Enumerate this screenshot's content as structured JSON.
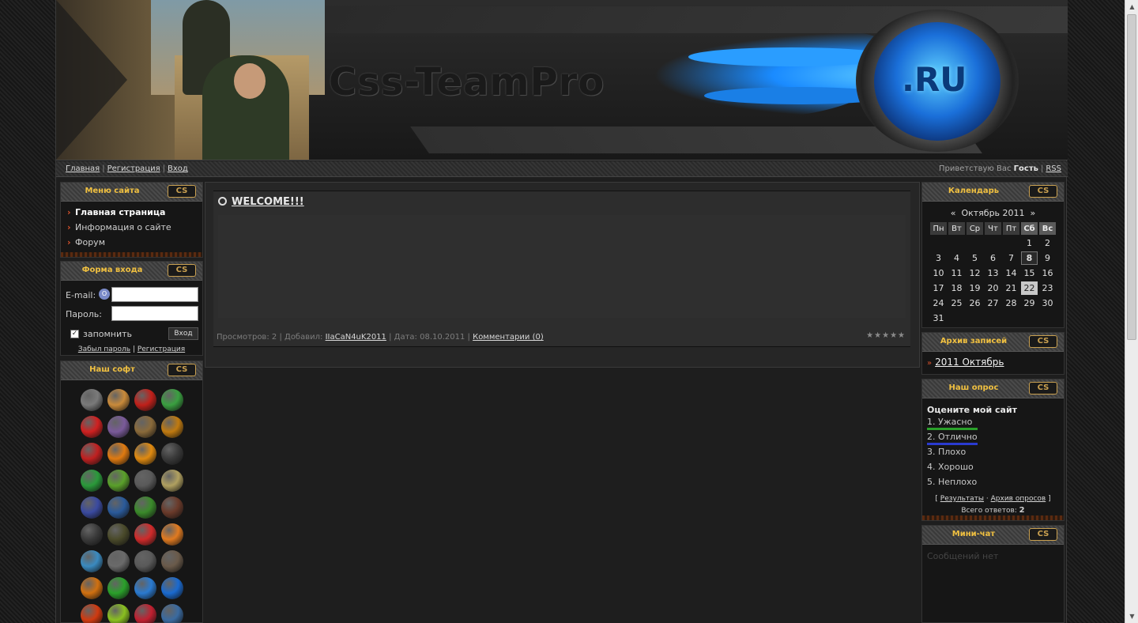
{
  "header": {
    "logo_text": "Css-TeamPro",
    "domain_badge": ".RU"
  },
  "nav": {
    "left": [
      "Главная",
      "Регистрация",
      "Вход"
    ],
    "greeting_prefix": "Приветствую Вас",
    "greeting_user": "Гость",
    "rss": "RSS"
  },
  "menu_block": {
    "title": "Меню сайта",
    "badge": "CS",
    "items": [
      "Главная страница",
      "Информация о сайте",
      "Форум"
    ]
  },
  "login_block": {
    "title": "Форма входа",
    "badge": "CS",
    "email_label": "E-mail:",
    "password_label": "Пароль:",
    "remember_label": "запомнить",
    "login_button": "Вход",
    "forgot_link": "Забыл пароль",
    "register_link": "Регистрация"
  },
  "soft_block": {
    "title": "Наш софт",
    "badge": "CS",
    "icon_colors": [
      "#7a7a7a",
      "#c98a3a",
      "#c0201a",
      "#3aa040",
      "#d02020",
      "#7a5a9a",
      "#8a6a3a",
      "#c07a10",
      "#c02020",
      "#e07a10",
      "#e08a10",
      "#3a3a3a",
      "#2a9a3a",
      "#5aa02a",
      "#5a5a5a",
      "#b0a060",
      "#3a4aa0",
      "#2a5a9a",
      "#3a8a2a",
      "#6a3a2a",
      "#3a3a3a",
      "#4a4a2a",
      "#d02a2a",
      "#e07a20",
      "#3a8ac0",
      "#6a6a6a",
      "#5a5a5a",
      "#6a5a4a",
      "#d07010",
      "#2aa02a",
      "#2a7ad0",
      "#1a6ad0",
      "#d03a10",
      "#8ac020",
      "#c02030",
      "#3a6aa0"
    ]
  },
  "entry": {
    "title": "WELCOME!!!",
    "views_label": "Просмотров:",
    "views": "2",
    "added_label": "Добавил:",
    "author": "IIaCaN4uK2011",
    "date_label": "Дата:",
    "date": "08.10.2011",
    "comments": "Комментарии (0)",
    "rating_stars": "★★★★★"
  },
  "calendar": {
    "title": "Календарь",
    "badge": "CS",
    "prev": "«",
    "month": "Октябрь 2011",
    "next": "»",
    "weekdays": [
      "Пн",
      "Вт",
      "Ср",
      "Чт",
      "Пт",
      "Сб",
      "Вс"
    ],
    "weeks": [
      [
        "",
        "",
        "",
        "",
        "",
        "1",
        "2"
      ],
      [
        "3",
        "4",
        "5",
        "6",
        "7",
        "8",
        "9"
      ],
      [
        "10",
        "11",
        "12",
        "13",
        "14",
        "15",
        "16"
      ],
      [
        "17",
        "18",
        "19",
        "20",
        "21",
        "22",
        "23"
      ],
      [
        "24",
        "25",
        "26",
        "27",
        "28",
        "29",
        "30"
      ],
      [
        "31",
        "",
        "",
        "",
        "",
        "",
        ""
      ]
    ],
    "bold_day": "8",
    "today": "22"
  },
  "archive_block": {
    "title": "Архив записей",
    "badge": "CS",
    "items": [
      "2011 Октябрь"
    ]
  },
  "poll_block": {
    "title": "Наш опрос",
    "badge": "CS",
    "question": "Оцените мой сайт",
    "options": [
      {
        "label": "1. Ужасно",
        "bar_color": "#2aa02a",
        "share": 0.5
      },
      {
        "label": "2. Отлично",
        "bar_color": "#2a3ad0",
        "share": 0.5
      },
      {
        "label": "3. Плохо",
        "bar_color": "",
        "share": 0
      },
      {
        "label": "4. Хорошо",
        "bar_color": "",
        "share": 0
      },
      {
        "label": "5. Неплохо",
        "bar_color": "",
        "share": 0
      }
    ],
    "results_link": "Результаты",
    "archive_link": "Архив опросов",
    "total_label": "Всего ответов:",
    "total": "2"
  },
  "chat_block": {
    "title": "Мини-чат",
    "badge": "CS",
    "empty": "Сообщений нет"
  }
}
